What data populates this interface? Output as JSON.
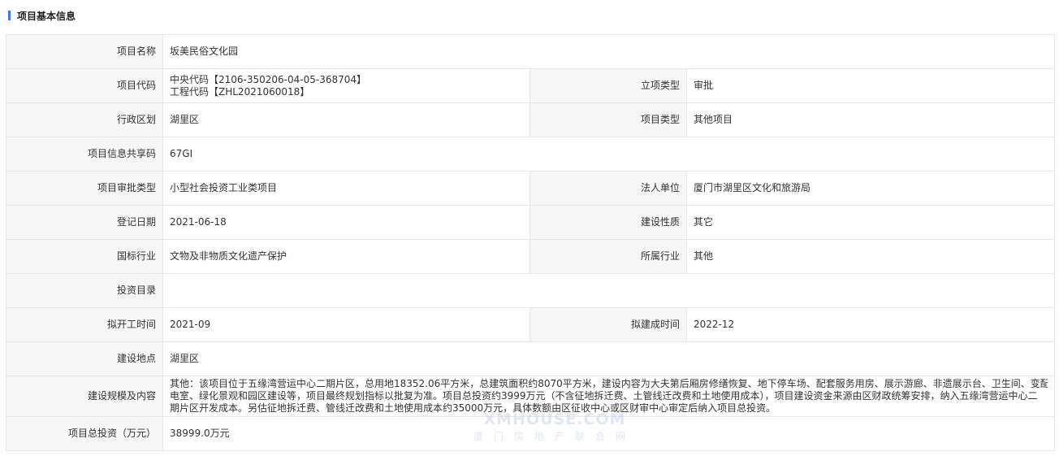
{
  "section": {
    "title": "项目基本信息"
  },
  "fields": {
    "project_name": {
      "label": "项目名称",
      "value": "坂美民俗文化园"
    },
    "project_code": {
      "label": "项目代码",
      "value_line1": "中央代码【2106-350206-04-05-368704】",
      "value_line2": "工程代码【ZHL2021060018】"
    },
    "approval_type": {
      "label": "立项类型",
      "value": "审批"
    },
    "district": {
      "label": "行政区划",
      "value": "湖里区"
    },
    "project_type": {
      "label": "项目类型",
      "value": "其他项目"
    },
    "share_code": {
      "label": "项目信息共享码",
      "value": "67GI"
    },
    "review_category": {
      "label": "项目审批类型",
      "value": "小型社会投资工业类项目"
    },
    "legal_unit": {
      "label": "法人单位",
      "value": "厦门市湖里区文化和旅游局"
    },
    "register_date": {
      "label": "登记日期",
      "value": "2021-06-18"
    },
    "construction_nature": {
      "label": "建设性质",
      "value": "其它"
    },
    "national_industry": {
      "label": "国标行业",
      "value": "文物及非物质文化遗产保护"
    },
    "industry": {
      "label": "所属行业",
      "value": "其他"
    },
    "investment_catalog": {
      "label": "投资目录",
      "value": ""
    },
    "planned_start": {
      "label": "拟开工时间",
      "value": "2021-09"
    },
    "planned_completion": {
      "label": "拟建成时间",
      "value": "2022-12"
    },
    "location": {
      "label": "建设地点",
      "value": "湖里区"
    },
    "scale_content": {
      "label": "建设规模及内容",
      "value_line1": "其他：该项目位于五缘湾营运中心二期片区，总用地18352.06平方米，总建筑面积约8070平方米，建设内容为大夫第后厢房修缮恢复、地下停车场、配套服务用房、展示游廊、非遗展示台、卫生间、变配",
      "value_line2": "电室、绿化景观和园区建设等，项目最终规划指标以批复为准。项目总投资约3999万元（不含征地拆迁费、土管线迁改费和土地使用成本），项目建设资金来源由区财政统筹安排，纳入五缘湾营运中心二",
      "value_line3": "期片区开发成本。另估征地拆迁费、管线迁改费和土地使用成本约35000万元，具体数额由区征收中心或区财审中心审定后纳入项目总投资。"
    },
    "total_investment": {
      "label": "项目总投资（万元）",
      "value": "38999.0万元"
    }
  },
  "watermark": {
    "line1": "XMHOUSE.COM",
    "line2": "厦门房地产联合网"
  },
  "colors": {
    "accent": "#3a78f2",
    "label_bg": "#f6f6f6",
    "border": "#e7e7e7"
  }
}
